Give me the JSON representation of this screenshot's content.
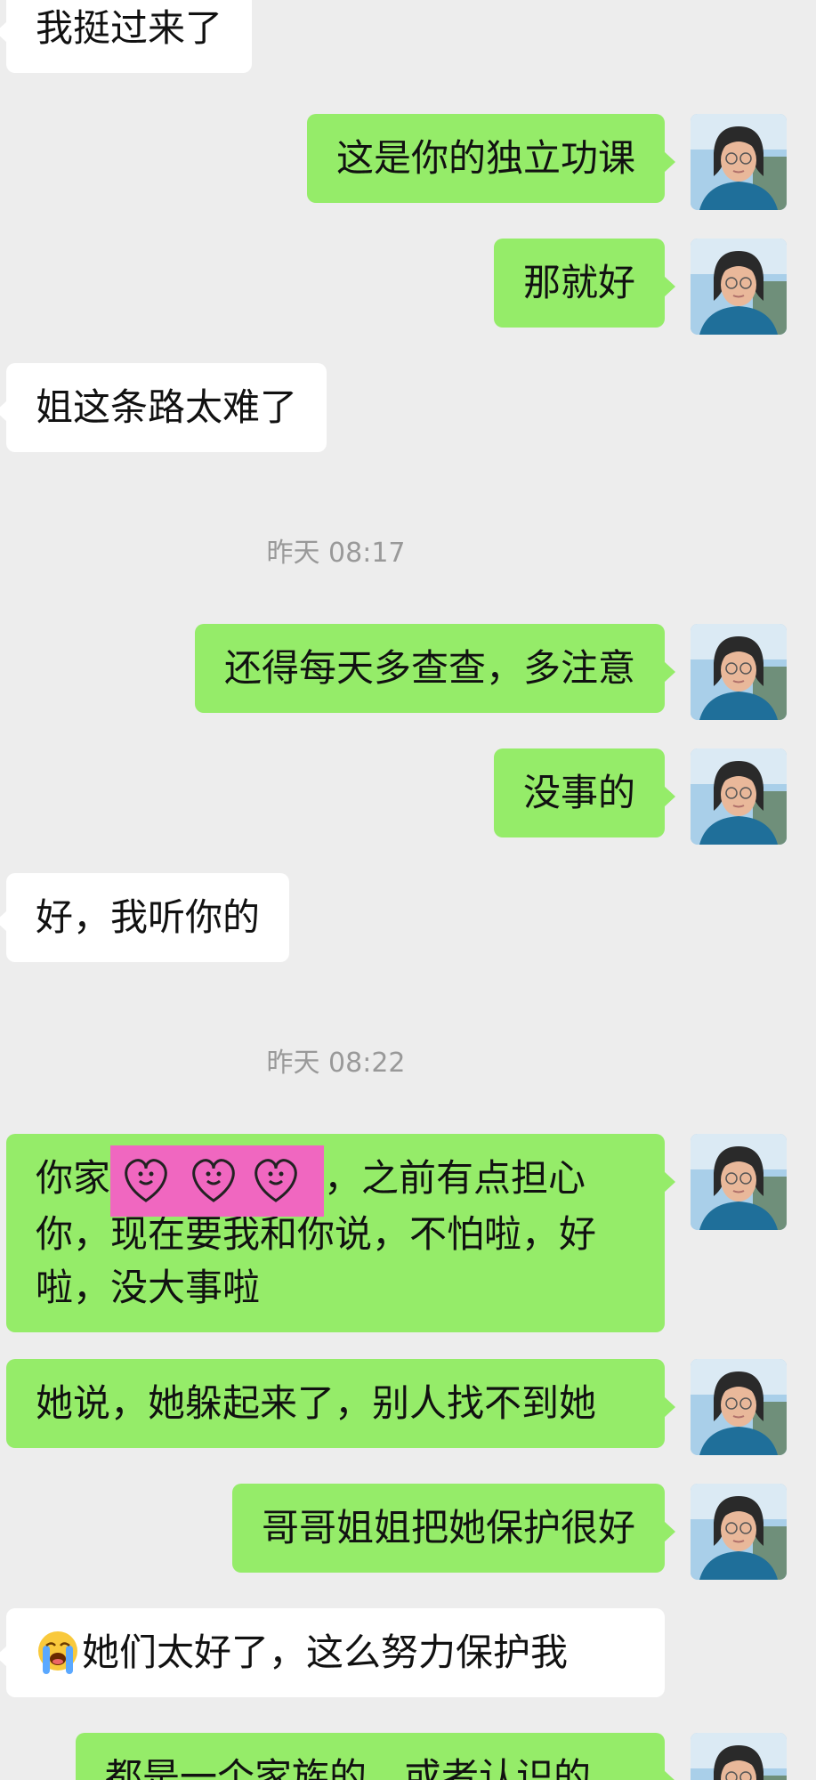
{
  "messages": [
    {
      "side": "in",
      "text": "我挺过来了"
    },
    {
      "side": "out",
      "text": "这是你的独立功课"
    },
    {
      "side": "out",
      "text": "那就好"
    },
    {
      "side": "in",
      "text": "姐这条路太难了"
    },
    {
      "timestamp": "昨天 08:17"
    },
    {
      "side": "out",
      "text": "还得每天多查查，多注意"
    },
    {
      "side": "out",
      "text": "没事的"
    },
    {
      "side": "in",
      "text": "好，我听你的"
    },
    {
      "timestamp": "昨天 08:22"
    },
    {
      "side": "out",
      "text_before_sticker": "你家",
      "sticker": "pink-hearts-sticker",
      "text_after_sticker": "，之前有点担心你，现在要我和你说，不怕啦，好啦，没大事啦"
    },
    {
      "side": "out",
      "text": "她说，她躲起来了，别人找不到她"
    },
    {
      "side": "out",
      "text": "哥哥姐姐把她保护很好"
    },
    {
      "side": "in",
      "emoji": "loudly-crying-face",
      "text": "她们太好了，这么努力保护我"
    },
    {
      "side": "out",
      "text": "都是一个家族的，或者认识的"
    }
  ],
  "colors": {
    "background": "#ededed",
    "outgoing": "#95ec69",
    "incoming": "#ffffff",
    "timestamp": "#999999"
  }
}
